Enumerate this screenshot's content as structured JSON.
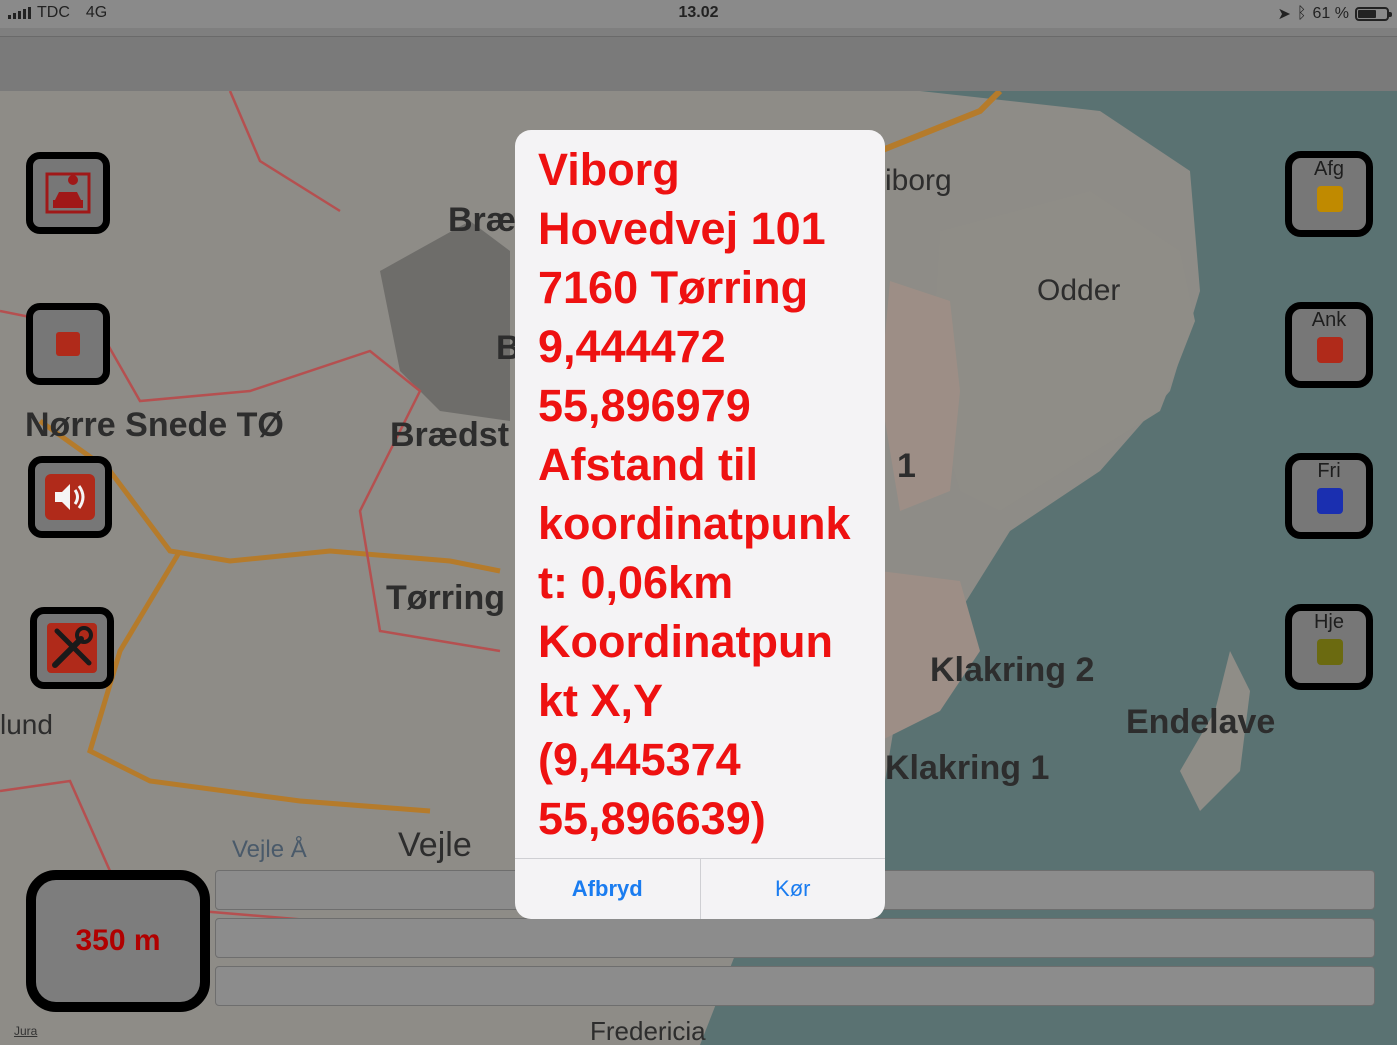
{
  "status_bar": {
    "carrier": "TDC",
    "network": "4G",
    "time": "13.02",
    "battery": "61 %"
  },
  "map": {
    "places": [
      "Nørre Snede TØ",
      "Bræ",
      "B",
      "Brædst",
      "Tørring",
      "Vejle",
      "Odder",
      "Klakring 2",
      "Klakring 1",
      "Endelave",
      "iborg",
      "1",
      "lund",
      "Fredericia",
      "Vejle Å"
    ],
    "attribution": "Jura"
  },
  "left_buttons": [
    "map-car-icon",
    "stop-icon",
    "speaker-icon",
    "wrench-screwdriver-icon"
  ],
  "scale_label": "350 m",
  "toggles": [
    {
      "label": "Afg",
      "color": "#c08a00"
    },
    {
      "label": "Ank",
      "color": "#b02a1a"
    },
    {
      "label": "Fri",
      "color": "#1a2fb0"
    },
    {
      "label": "Hje",
      "color": "#6b6a10"
    }
  ],
  "alert": {
    "lines": [
      "Viborg",
      "Hovedvej 101",
      "7160 Tørring",
      "9,444472",
      "55,896979",
      "Afstand til",
      "koordinatpunk",
      "t: 0,06km",
      "Koordinatpun",
      "kt X,Y",
      "(9,445374",
      "55,896639)"
    ],
    "cancel": "Afbryd",
    "run": "Kør"
  }
}
